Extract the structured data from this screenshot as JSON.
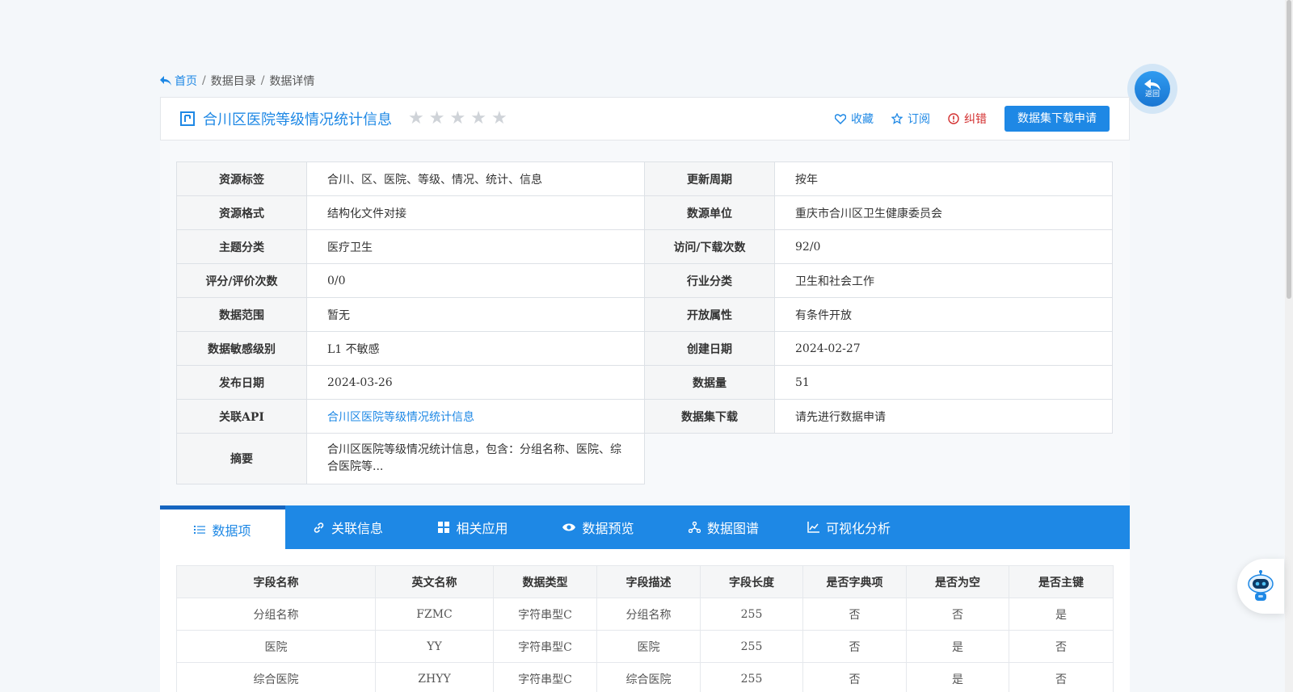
{
  "breadcrumb": {
    "home": "首页",
    "sep": "/",
    "catalog": "数据目录",
    "detail": "数据详情"
  },
  "back_button": {
    "label": "返回"
  },
  "title": "合川区医院等级情况统计信息",
  "rating": {
    "filled": 0,
    "total": 5
  },
  "actions": {
    "favorite": "收藏",
    "subscribe": "订阅",
    "report": "纠错",
    "apply": "数据集下载申请"
  },
  "info": {
    "rows": [
      {
        "l1": "资源标签",
        "v1": "合川、区、医院、等级、情况、统计、信息",
        "l2": "更新周期",
        "v2": "按年"
      },
      {
        "l1": "资源格式",
        "v1": "结构化文件对接",
        "l2": "数源单位",
        "v2": "重庆市合川区卫生健康委员会"
      },
      {
        "l1": "主题分类",
        "v1": "医疗卫生",
        "l2": "访问/下载次数",
        "v2": "92/0"
      },
      {
        "l1": "评分/评价次数",
        "v1": "0/0",
        "l2": "行业分类",
        "v2": "卫生和社会工作"
      },
      {
        "l1": "数据范围",
        "v1": "暂无",
        "l2": "开放属性",
        "v2": "有条件开放"
      },
      {
        "l1": "数据敏感级别",
        "v1": "L1 不敏感",
        "l2": "创建日期",
        "v2": "2024-02-27"
      },
      {
        "l1": "发布日期",
        "v1": "2024-03-26",
        "l2": "数据量",
        "v2": "51"
      },
      {
        "l1": "关联API",
        "v1": "合川区医院等级情况统计信息",
        "l2": "数据集下载",
        "v2": "请先进行数据申请"
      }
    ],
    "abstract_label": "摘要",
    "abstract": "合川区医院等级情况统计信息，包含：分组名称、医院、综合医院等..."
  },
  "tabs": [
    "数据项",
    "关联信息",
    "相关应用",
    "数据预览",
    "数据图谱",
    "可视化分析"
  ],
  "fields": {
    "headers": [
      "字段名称",
      "英文名称",
      "数据类型",
      "字段描述",
      "字段长度",
      "是否字典项",
      "是否为空",
      "是否主键"
    ],
    "rows": [
      [
        "分组名称",
        "FZMC",
        "字符串型C",
        "分组名称",
        "255",
        "否",
        "否",
        "是"
      ],
      [
        "医院",
        "YY",
        "字符串型C",
        "医院",
        "255",
        "否",
        "是",
        "否"
      ],
      [
        "综合医院",
        "ZHYY",
        "字符串型C",
        "综合医院",
        "255",
        "否",
        "是",
        "否"
      ]
    ]
  },
  "colors": {
    "primary": "#1e88e5",
    "danger": "#d32f2f",
    "star": "#cfd3d8"
  }
}
